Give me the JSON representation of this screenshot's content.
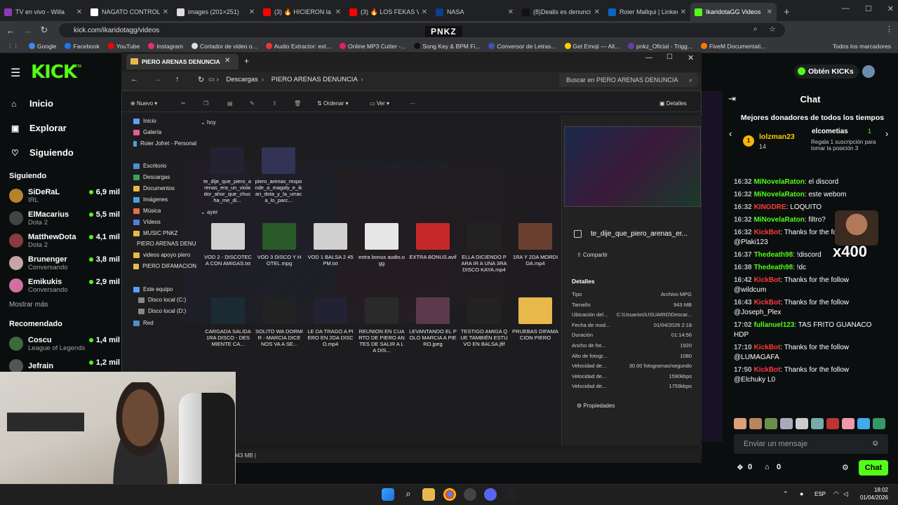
{
  "browser": {
    "tabs": [
      {
        "title": "TV en vivo - Willa",
        "color": "#8a3ab9"
      },
      {
        "title": "NAGATO CONTROLA",
        "color": "#ffffff"
      },
      {
        "title": "images (201×251)",
        "color": "#dddddd"
      },
      {
        "title": "(3) 🔥 HICIERON la V",
        "color": "#ff0000"
      },
      {
        "title": "(3) 🔥 LOS FEKAS VS",
        "color": "#ff0000"
      },
      {
        "title": "NASA",
        "color": "#0b3d91"
      },
      {
        "title": "(8)Dealis es denunci",
        "color": "#111111"
      },
      {
        "title": "Roier Mallqui | LinkedIn",
        "color": "#0a66c2"
      },
      {
        "title": "IkaridotaGG Videos",
        "color": "#53fc18"
      }
    ],
    "url": "kick.com/ikaridotagg/videos",
    "overlay_brand": "PNKZ",
    "bookmarks": [
      "Google",
      "Facebook",
      "YouTube",
      "Instagram",
      "Cortador de video o...",
      "Audio Extractor: ext...",
      "Online MP3 Cutter -...",
      "Song Key & BPM Fi...",
      "Conversor de Letras...",
      "Get Emoji — All...",
      "pnkz_Oficial - Trigg...",
      "FiveM Documentati..."
    ],
    "bookmark_colors": [
      "#4285f4",
      "#1877f2",
      "#ff0000",
      "#e1306c",
      "#e0e0e0",
      "#e53935",
      "#e91e63",
      "#111111",
      "#3f51b5",
      "#ffcc00",
      "#6441a5",
      "#f57c00"
    ],
    "all_bookmarks": "Todos los marcadores"
  },
  "kick": {
    "logo": "KICK",
    "beta": "BETA",
    "nav": [
      {
        "label": "Inicio",
        "icon": "home-icon"
      },
      {
        "label": "Explorar",
        "icon": "compass-icon"
      },
      {
        "label": "Siguiendo",
        "icon": "heart-icon"
      }
    ],
    "following_title": "Siguiendo",
    "following": [
      {
        "name": "SiDeRaL",
        "game": "IRL",
        "viewers": "6,9 mil",
        "color": "#b5832a"
      },
      {
        "name": "ElMacarius",
        "game": "Dota 2",
        "viewers": "5,5 mil",
        "color": "#444"
      },
      {
        "name": "MatthewDota",
        "game": "Dota 2",
        "viewers": "4,1 mil",
        "color": "#8a3b3b"
      },
      {
        "name": "Brunenger",
        "game": "Conversando",
        "viewers": "3,8 mil",
        "color": "#c8a4a4"
      },
      {
        "name": "Emikukis",
        "game": "Conversando",
        "viewers": "2,9 mil",
        "color": "#d070a0"
      }
    ],
    "show_more": "Mostrar más",
    "recommended_title": "Recomendado",
    "recommended": [
      {
        "name": "Coscu",
        "game": "League of Legends",
        "viewers": "1,4 mil",
        "color": "#3a6b3a"
      },
      {
        "name": "Jefrain",
        "game": "",
        "viewers": "1,2 mil",
        "color": "#555"
      }
    ],
    "get_kicks": "Obtén KICKs"
  },
  "chat": {
    "title": "Chat",
    "donors_title": "Mejores donadores de todos los tiempos",
    "top_donor": {
      "name": "lolzman23",
      "amount": "14"
    },
    "second_donor": {
      "name": "elcometias",
      "amount": "1",
      "note": "Regala 1 suscripción para tomar la posición 3"
    },
    "messages": [
      {
        "time": "16:32",
        "user": "MiNovelaRaton",
        "color": "#53fc18",
        "text": "el discord"
      },
      {
        "time": "16:32",
        "user": "MiNovelaRaton",
        "color": "#53fc18",
        "text": "este webom"
      },
      {
        "time": "16:32",
        "user": "KINGDRE",
        "color": "#ff3a3a",
        "text": "LOQUITO"
      },
      {
        "time": "16:32",
        "user": "MiNovelaRaton",
        "color": "#53fc18",
        "text": "filtro?"
      },
      {
        "time": "16:32",
        "user": "KickBot",
        "color": "#ff3a3a",
        "text": "Thanks for the follow @Plaki123"
      },
      {
        "time": "16:37",
        "user": "Thedeath98",
        "color": "#53fc18",
        "text": "!discord"
      },
      {
        "time": "16:38",
        "user": "Thedeath98",
        "color": "#53fc18",
        "text": "!dc"
      },
      {
        "time": "16:42",
        "user": "KickBot",
        "color": "#ff3a3a",
        "text": "Thanks for the follow @wildcum"
      },
      {
        "time": "16:43",
        "user": "KickBot",
        "color": "#ff3a3a",
        "text": "Thanks for the follow @Joseph_Plex"
      },
      {
        "time": "17:02",
        "user": "fullanuel123",
        "color": "#53fc18",
        "text": "TAS FRITO GUANACO HDP"
      },
      {
        "time": "17:10",
        "user": "KickBot",
        "color": "#ff3a3a",
        "text": "Thanks for the follow @LUMAGAFA"
      },
      {
        "time": "17:50",
        "user": "KickBot",
        "color": "#ff3a3a",
        "text": "Thanks for the follow @Elchuky L0"
      }
    ],
    "emote_badge": "x400",
    "input_placeholder": "Enviar un mensaje",
    "points": "0",
    "gifts": "0",
    "send_label": "Chat"
  },
  "explorer": {
    "tab_title": "PIERO ARENAS DENUNCIA",
    "breadcrumb": [
      "Descargas",
      "PIERO ARENAS DENUNCIA"
    ],
    "search_placeholder": "Buscar en PIERO ARENAS DENUNCIA",
    "toolbar": {
      "new": "Nuevo",
      "sort": "Ordenar",
      "view": "Ver",
      "details": "Detalles"
    },
    "sidebar": [
      "Inicio",
      "Galería",
      "Roier Jofret - Personal",
      "Escritorio",
      "Descargas",
      "Documentos",
      "Imágenes",
      "Música",
      "Vídeos",
      "MUSIC PNKZ",
      "PIERO ARENAS DENUNCIA",
      "videos apoyo piero",
      "PIERO DIFAMACION",
      "Este equipo",
      "Disco local (C:)",
      "Disco local (D:)",
      "Red"
    ],
    "group_today": "hoy",
    "group_yesterday": "ayer",
    "files_today": [
      {
        "name": "te_dije_que_piero_arenas_era_un_violador_ahor_que_chucha_me_di...",
        "color": "#223"
      },
      {
        "name": "piero_arenas_responde_a_magaly_e_ikari_dota_y_la_urraca_lo_parc...",
        "color": "#335"
      }
    ],
    "files_yesterday": [
      {
        "name": "VOD 2 - DISCOTECA CON AMIGAS.txt",
        "color": "#d0d0d0"
      },
      {
        "name": "VOD 3 DISCO Y HOTEL.mpg",
        "color": "#2a5a2a"
      },
      {
        "name": "VOD 1 BALSA 2 45 PM.txt",
        "color": "#d0d0d0"
      },
      {
        "name": "extra bonus audio.ogg",
        "color": "#e6e6e6"
      },
      {
        "name": "EXTRA BONUS.avif",
        "color": "#c62828"
      },
      {
        "name": "ELLA DICIENDO PARA IR A UNA 3RA DISCO KAYA.mp4",
        "color": "#222"
      },
      {
        "name": "1RA Y 2DA MORDIDA.mp4",
        "color": "#6a4030"
      },
      {
        "name": "CARGADA SALIDA 1RA DISCO - DESMIENTE CA...",
        "color": "#1b2b33"
      },
      {
        "name": "SOLITO WA DORMIR - MARCIA DICE NOS VA A SE...",
        "color": "#222"
      },
      {
        "name": "LE DA TRAGO A PIERO EN 2DA DISCO.mp4",
        "color": "#223"
      },
      {
        "name": "REUNION EN CUARTO DE PIERO ANTES DE SALIR A LA DIS...",
        "color": "#2a2a2a"
      },
      {
        "name": "LEVANTANDO EL POLO MARCIA A PIERO.jpeg",
        "color": "#5a3a4a"
      },
      {
        "name": "TESTIGO AMIGA QUE TAMBIÉN ESTUVO EN BALSA.jfif",
        "color": "#222"
      },
      {
        "name": "PRUEBAS DIFAMACION PIERO",
        "color": "#e8b94a"
      }
    ],
    "details": {
      "selected_name": "te_dije_que_piero_arenas_er...",
      "share": "Compartir",
      "section": "Detalles",
      "rows": [
        {
          "k": "Tipo",
          "v": "Archivo MPG"
        },
        {
          "k": "Tamaño",
          "v": "943 MB"
        },
        {
          "k": "Ubicación del...",
          "v": "C:\\Usuarios\\USUARIO\\Descar..."
        },
        {
          "k": "Fecha de mod...",
          "v": "01/04/2026 2:18"
        },
        {
          "k": "Duración",
          "v": "01:14:56"
        },
        {
          "k": "Ancho de fot...",
          "v": "1920"
        },
        {
          "k": "Alto de fotogr...",
          "v": "1080"
        },
        {
          "k": "Velocidad de...",
          "v": "30.00 fotogramas/segundo"
        },
        {
          "k": "Velocidad de...",
          "v": "1590kbps"
        },
        {
          "k": "Velocidad de...",
          "v": "1759kbps"
        }
      ],
      "properties": "Propiedades"
    },
    "status": "943 MB"
  },
  "taskbar": {
    "lang": "ESP",
    "time": "18:02",
    "date": "01/04/2026"
  }
}
